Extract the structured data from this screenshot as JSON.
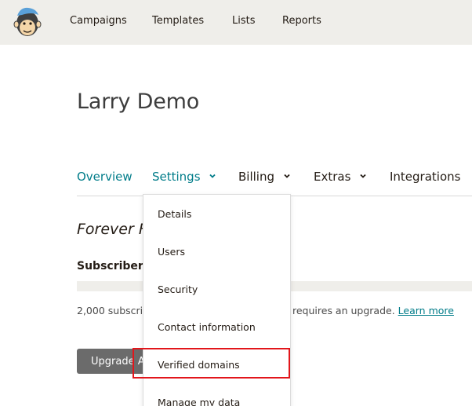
{
  "topnav": {
    "items": [
      {
        "label": "Campaigns"
      },
      {
        "label": "Templates"
      },
      {
        "label": "Lists"
      },
      {
        "label": "Reports"
      }
    ]
  },
  "account": {
    "title": "Larry Demo"
  },
  "tabs": {
    "items": [
      {
        "label": "Overview"
      },
      {
        "label": "Settings"
      },
      {
        "label": "Billing"
      },
      {
        "label": "Extras"
      },
      {
        "label": "Integrations"
      }
    ]
  },
  "plan": {
    "title": "Forever F",
    "subscribers_label": "Subscribers",
    "text_left": "2,000 subscrib",
    "text_right": "requires an upgrade.",
    "learn_more": "Learn more",
    "upgrade_button": "Upgrade A"
  },
  "settings_menu": {
    "items": [
      {
        "label": "Details"
      },
      {
        "label": "Users"
      },
      {
        "label": "Security"
      },
      {
        "label": "Contact information"
      },
      {
        "label": "Verified domains"
      },
      {
        "label": "Manage my data"
      }
    ],
    "highlighted": "Verified domains"
  },
  "colors": {
    "accent": "#007c89",
    "topbar": "#efeeea",
    "highlight": "#e2161b",
    "button": "#6b6b6b"
  }
}
